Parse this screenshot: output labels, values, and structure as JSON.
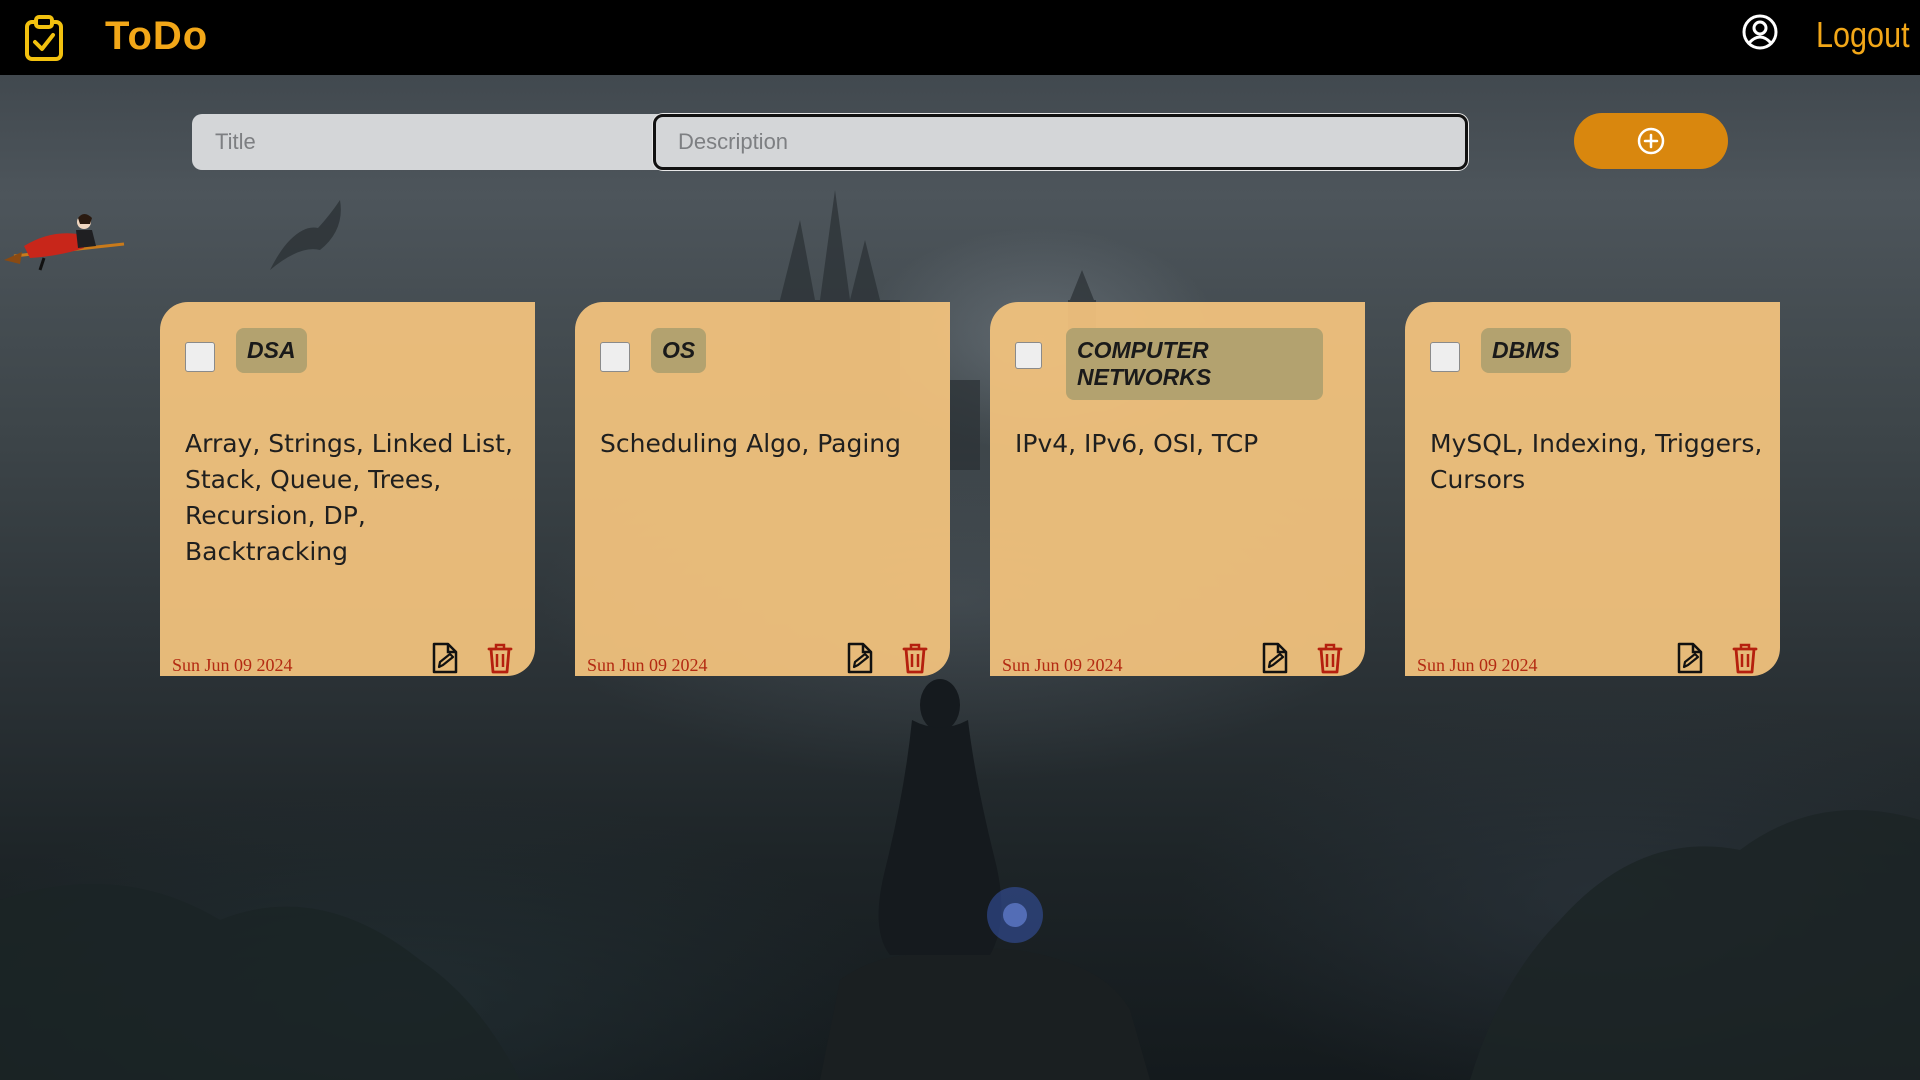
{
  "header": {
    "brand": "ToDo",
    "brand_icon": "clipboard-check-icon",
    "account_icon": "user-circle-icon",
    "logout_label": "Logout"
  },
  "form": {
    "title_placeholder": "Title",
    "title_value": "",
    "description_placeholder": "Description",
    "description_value": "",
    "add_icon": "plus-circle-icon"
  },
  "colors": {
    "accent": "#f2a718",
    "button": "#d9870e",
    "card": "#f2c27d",
    "tag": "#b3a26f",
    "date": "#b32a12",
    "delete": "#b5200e"
  },
  "todos": [
    {
      "tag": "DSA",
      "description": "Array, Strings, Linked List, Stack, Queue, Trees, Recursion, DP, Backtracking",
      "date": "Sun Jun 09 2024",
      "completed": false
    },
    {
      "tag": "OS",
      "description": "Scheduling Algo, Paging",
      "date": "Sun Jun 09 2024",
      "completed": false
    },
    {
      "tag": "COMPUTER NETWORKS",
      "description": "IPv4, IPv6, OSI, TCP",
      "date": "Sun Jun 09 2024",
      "completed": false
    },
    {
      "tag": "DBMS",
      "description": "MySQL, Indexing, Triggers, Cursors",
      "date": "Sun Jun 09 2024",
      "completed": false
    }
  ]
}
